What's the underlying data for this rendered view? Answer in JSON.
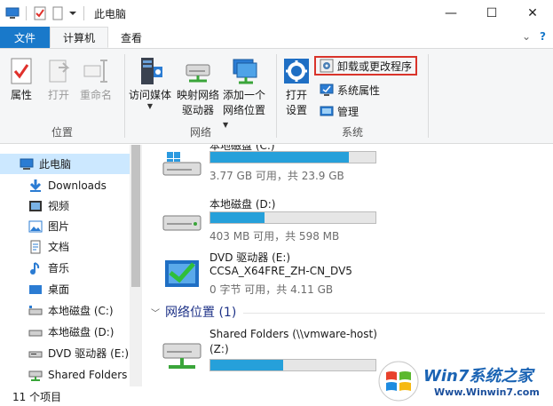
{
  "window": {
    "title": "此电脑",
    "minimize": "—",
    "maximize": "☐",
    "close": "✕"
  },
  "tabs": {
    "file": "文件",
    "computer": "计算机",
    "view": "查看",
    "caret": "⌄",
    "help": "?"
  },
  "ribbon": {
    "location": {
      "label": "位置",
      "properties": "属性",
      "open": "打开",
      "rename": "重命名"
    },
    "network": {
      "label": "网络",
      "access_media": "访问媒体",
      "map_drive_line1": "映射网络",
      "map_drive_line2": "驱动器",
      "add_location_line1": "添加一个",
      "add_location_line2": "网络位置"
    },
    "system": {
      "label": "系统",
      "open_settings_line1": "打开",
      "open_settings_line2": "设置",
      "uninstall": "卸载或更改程序",
      "system_properties": "系统属性",
      "manage": "管理"
    },
    "colors": {
      "highlight_border": "#d9342b"
    }
  },
  "nav": {
    "items": [
      {
        "label": "此电脑",
        "icon": "computer-icon"
      },
      {
        "label": "Downloads",
        "icon": "download-arrow-icon"
      },
      {
        "label": "视频",
        "icon": "video-icon"
      },
      {
        "label": "图片",
        "icon": "picture-icon"
      },
      {
        "label": "文档",
        "icon": "document-icon"
      },
      {
        "label": "音乐",
        "icon": "music-icon"
      },
      {
        "label": "桌面",
        "icon": "desktop-icon"
      },
      {
        "label": "本地磁盘 (C:)",
        "icon": "drive-icon"
      },
      {
        "label": "本地磁盘 (D:)",
        "icon": "drive-icon"
      },
      {
        "label": "DVD 驱动器 (E:)",
        "icon": "dvd-icon"
      },
      {
        "label": "Shared Folders",
        "icon": "network-drive-icon"
      }
    ]
  },
  "content": {
    "drives": [
      {
        "name": "本地磁盘 (C:)",
        "info": "3.77 GB 可用，共 23.9 GB",
        "used_fraction": 0.84,
        "icon": "windows-drive-icon"
      },
      {
        "name": "本地磁盘 (D:)",
        "info": "403 MB 可用，共 598 MB",
        "used_fraction": 0.33,
        "icon": "drive-icon"
      },
      {
        "name": "DVD 驱动器 (E:)",
        "name2": "CCSA_X64FRE_ZH-CN_DV5",
        "info": "0 字节 可用，共 4.11 GB",
        "icon": "dvd-drive-icon"
      }
    ],
    "network_section": {
      "title": "网络位置 (1)"
    },
    "network_drives": [
      {
        "name": "Shared Folders (\\\\vmware-host)",
        "name2": "(Z:)",
        "used_fraction": 0.44,
        "icon": "network-drive-icon"
      }
    ],
    "colors": {
      "bar_fill": "#26a0da",
      "section_title": "#1e3287"
    }
  },
  "status": {
    "count": "11 个项目"
  },
  "watermark": {
    "brand": "Win7系统之家",
    "url": "Www.Winwin7.com"
  }
}
